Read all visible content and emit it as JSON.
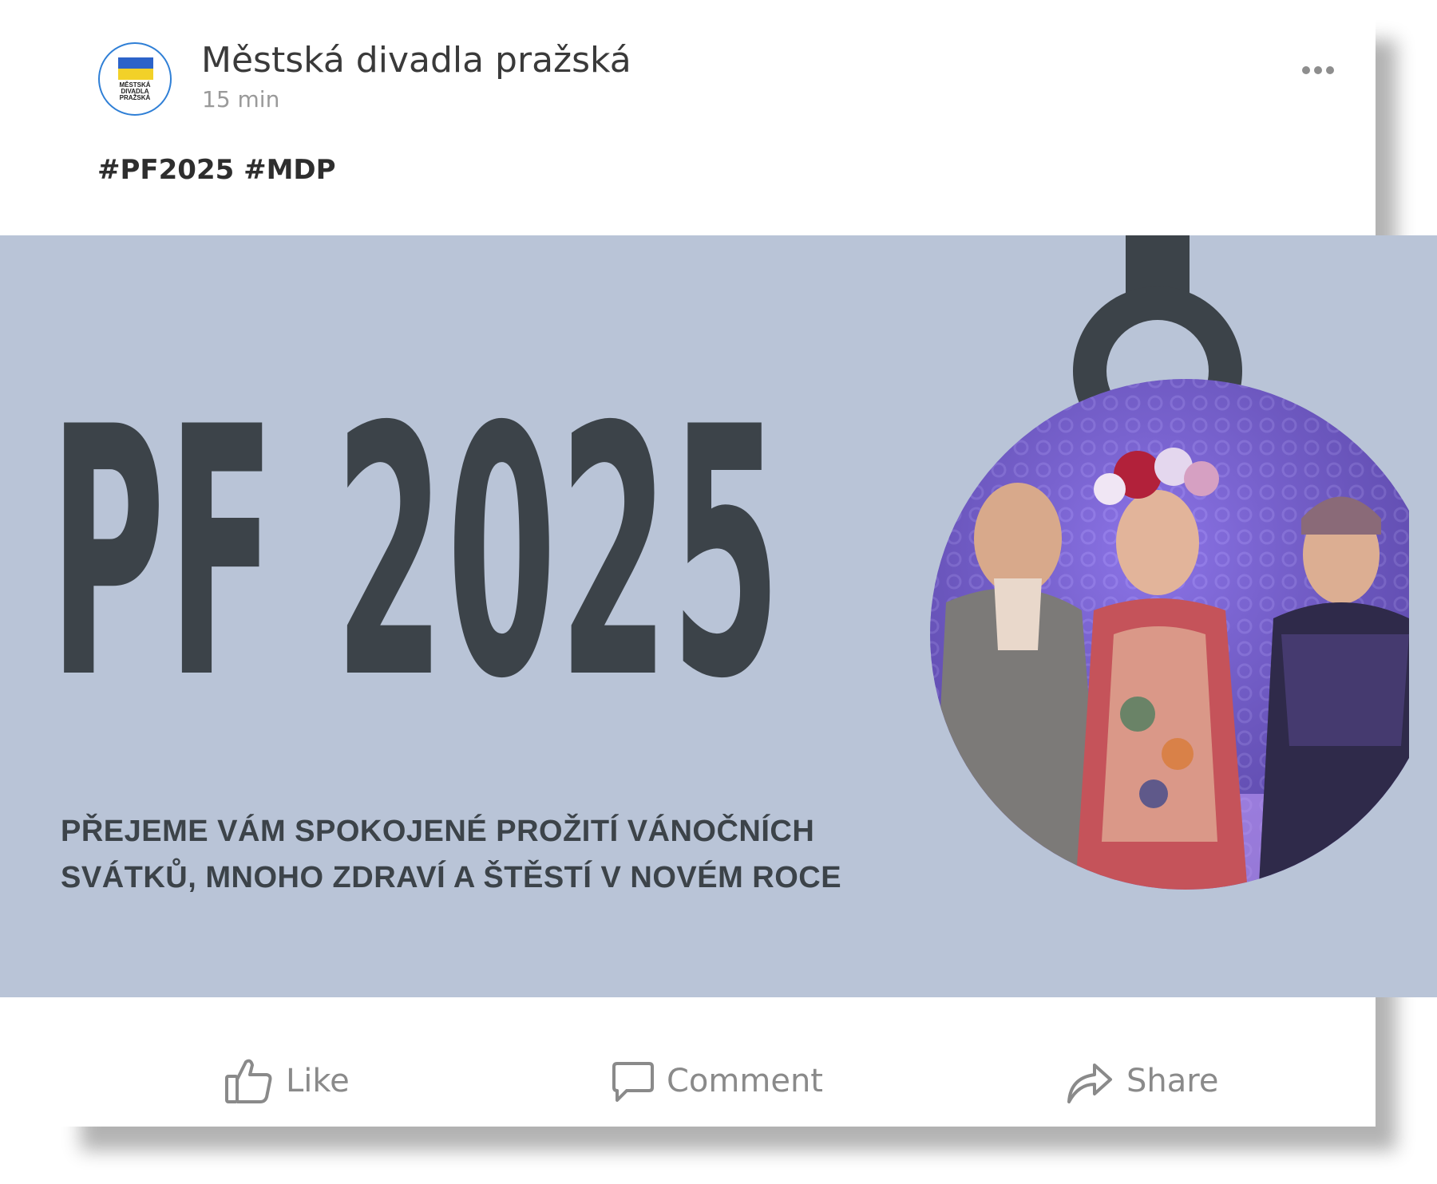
{
  "post": {
    "page_name": "Městská divadla pražská",
    "timestamp": "15 min",
    "avatar": {
      "logo_lines": [
        "MĚSTSKÁ",
        "DIVADLA",
        "PRAŽSKÁ"
      ],
      "flag_colors": [
        "#2c63c9",
        "#f2d128"
      ]
    },
    "more_icon": "more-horizontal-icon",
    "text": "#PF2025 #MDP"
  },
  "banner": {
    "title": "PF 2025",
    "greeting_line1": "PŘEJEME VÁM SPOKOJENÉ PROŽITÍ VÁNOČNÍCH",
    "greeting_line2": "SVÁTKŮ, MNOHO ZDRAVÍ A ŠTĚSTÍ V NOVÉM ROCE",
    "background_color": "#b9c4d7",
    "ink_color": "#3c4349",
    "photo_description_icon": "christmas-ornament-photo"
  },
  "actions": {
    "like_label": "Like",
    "like_icon": "thumbs-up-icon",
    "comment_label": "Comment",
    "comment_icon": "comment-icon",
    "share_label": "Share",
    "share_icon": "share-arrow-icon"
  }
}
